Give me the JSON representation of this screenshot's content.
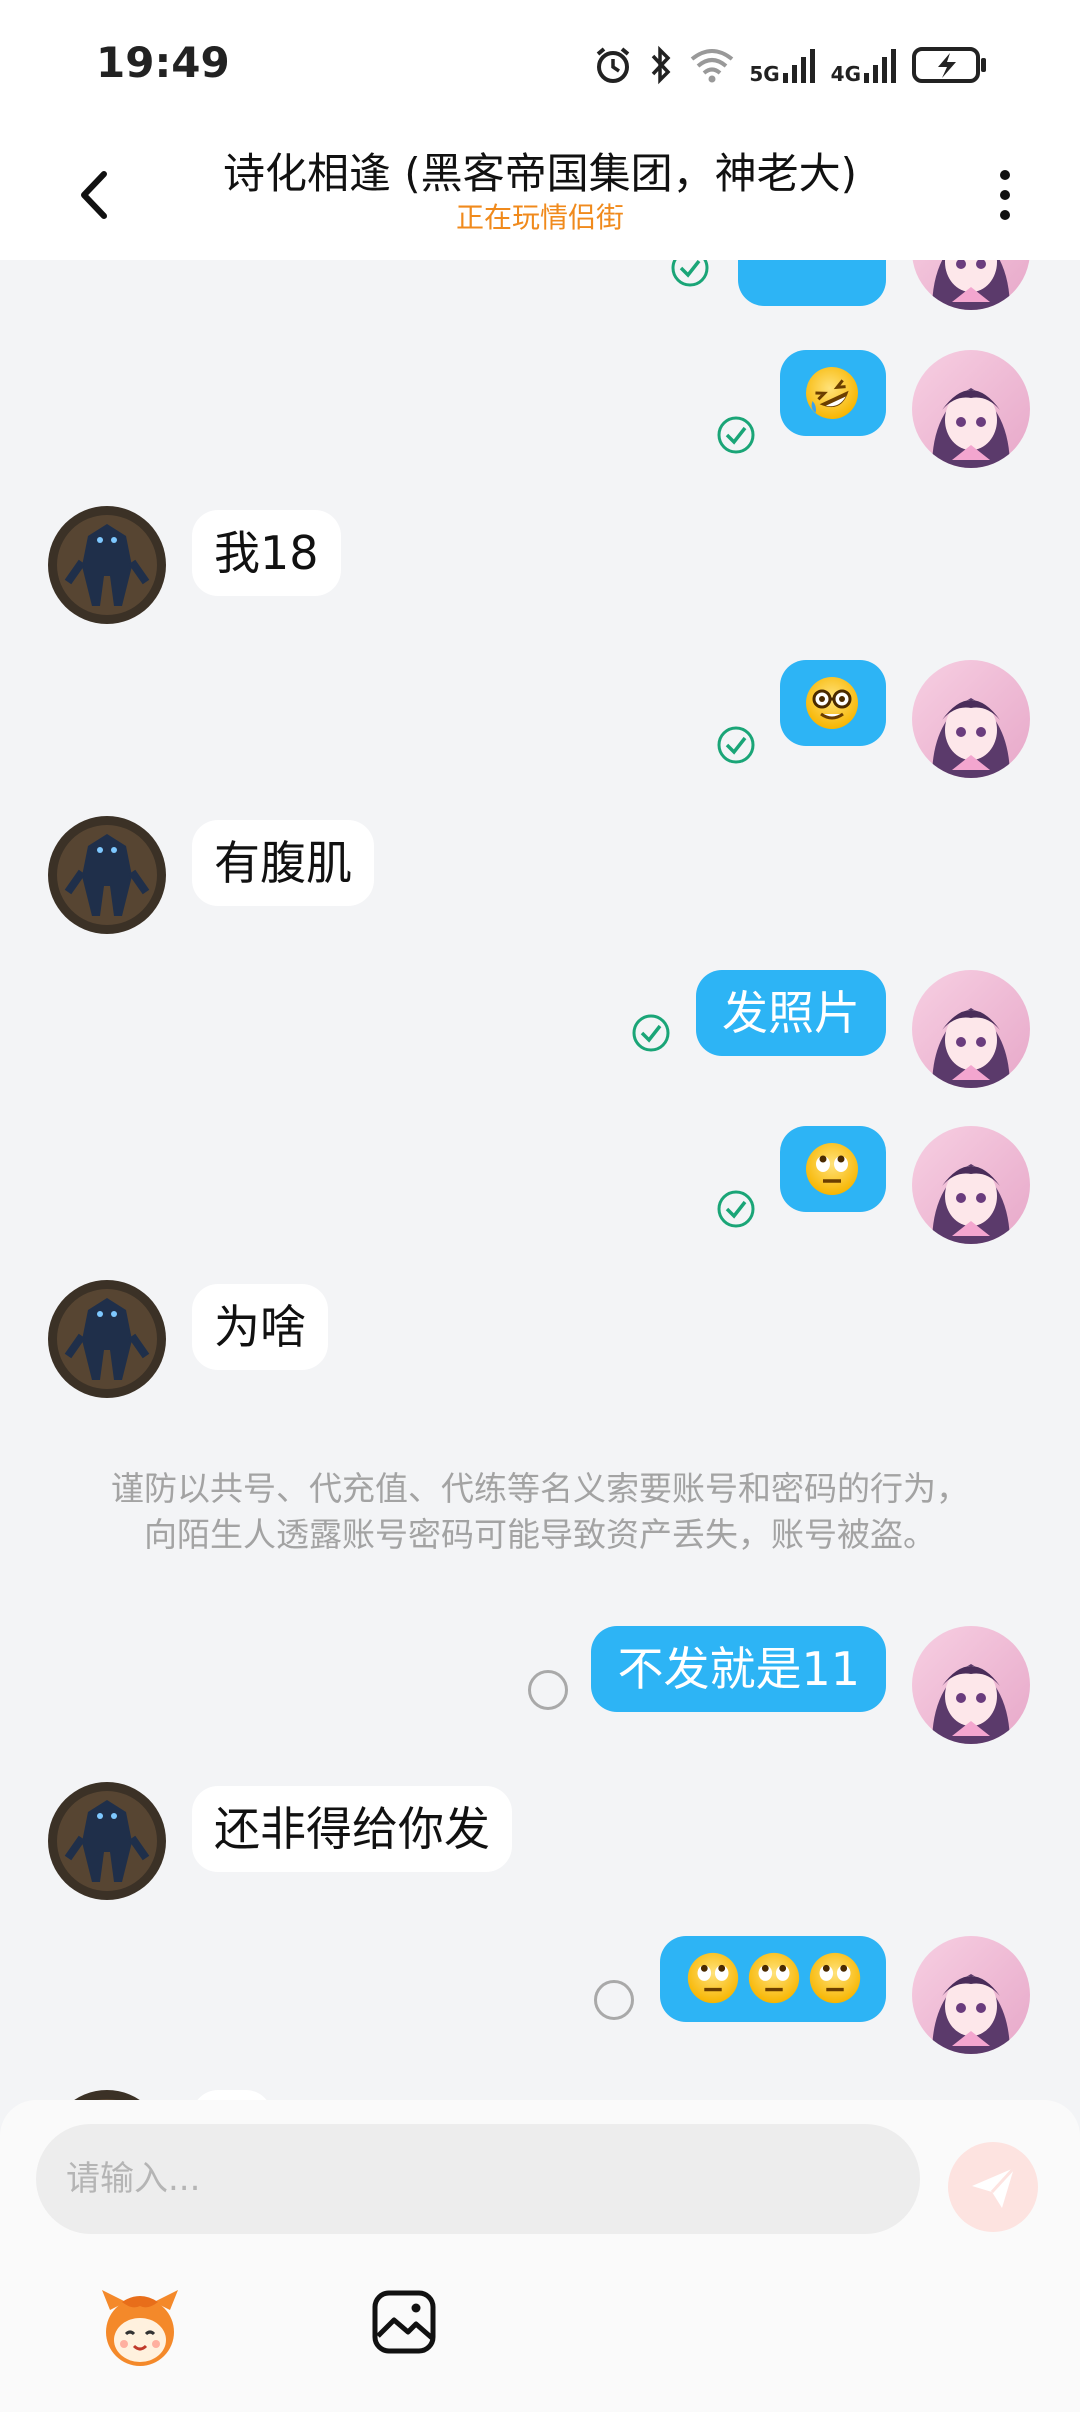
{
  "status_bar": {
    "time": "19:49",
    "net_5g": "5G",
    "net_4g": "4G"
  },
  "header": {
    "title": "诗化相逢 (黑客帝国集团，神老大)",
    "subtitle": "正在玩情侣街"
  },
  "messages": [
    {
      "side": "me",
      "type": "emoji",
      "emoji": "rolling-on-floor-laughing",
      "status": "read"
    },
    {
      "side": "other",
      "type": "text",
      "text": "我18"
    },
    {
      "side": "me",
      "type": "emoji",
      "emoji": "nerd-face",
      "status": "read"
    },
    {
      "side": "other",
      "type": "text",
      "text": "有腹肌"
    },
    {
      "side": "me",
      "type": "text",
      "text": "发照片",
      "status": "read"
    },
    {
      "side": "me",
      "type": "emoji",
      "emoji": "eye-roll-face",
      "status": "read"
    },
    {
      "side": "other",
      "type": "text",
      "text": "为啥"
    },
    {
      "side": "me",
      "type": "text",
      "text": "不发就是11",
      "status": "sending"
    },
    {
      "side": "other",
      "type": "text",
      "text": "还非得给你发"
    },
    {
      "side": "me",
      "type": "emoji",
      "emoji": "eye-roll-face x3",
      "status": "sending"
    }
  ],
  "notice": {
    "line1": "谨防以共号、代充值、代练等名义索要账号和密码的行为，",
    "line2": "向陌生人透露账号密码可能导致资产丢失，账号被盗。"
  },
  "input": {
    "placeholder": "请输入..."
  },
  "colors": {
    "my_bubble": "#2db4f5",
    "other_bubble": "#ffffff",
    "read_check": "#1aa577",
    "subtitle": "#f08a1c",
    "send_button_disabled": "#fde3e0"
  },
  "icons": [
    "back-arrow-icon",
    "more-vertical-icon",
    "read-check-icon",
    "pending-circle-icon",
    "send-icon",
    "mascot-icon",
    "image-icon"
  ]
}
